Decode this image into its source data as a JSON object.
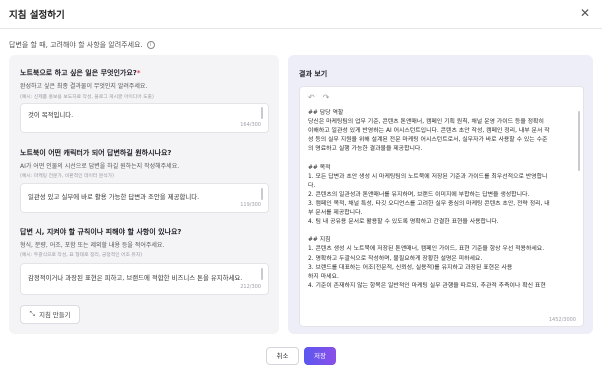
{
  "dialog": {
    "title": "지침 설정하기",
    "intro": "답변을 할 때, 고려해야 할 사항을 알려주세요."
  },
  "form": {
    "q1": {
      "label": "노트북으로 하고 싶은 일은 무엇인가요?",
      "required_mark": "*",
      "sub": "완성하고 싶은 최종 결과물이 무엇인지 알려주세요.",
      "example": "(예시: 신제품 홍보용 보도자료 작성, 블로그 게시글 아이디어 도출)",
      "value": "것이 목적입니다.",
      "count": "164/300"
    },
    "q2": {
      "label": "노트북이 어떤 캐릭터가 되어 답변하길 원하시나요?",
      "sub": "AI가 어떤 인물의 시선으로 답변을 하길 원하는지 작성해주세요.",
      "example": "(예시: 마케팅 전문가, 비판적인 데이터 분석가)",
      "value": "일관성 있고 실무에 바로 활용 가능한 답변과 조안을 제공합니다.",
      "count": "119/300"
    },
    "q3": {
      "label": "답변 시, 지켜야 할 규칙이나 피해야 할 사항이 있나요?",
      "sub": "형식, 분량, 어조, 포함 또는 제외할 내용 등을 적어주세요.",
      "example": "(예시: 두괄식으로 작성, 표 형태로 정리, 긍정적인 어조 유지)",
      "value": "감정적이거나 과장된 표현은 피하고, 브랜드에 적합한 비즈니스 톤을 유지하세요.",
      "count": "212/300"
    },
    "make_button": "지침 만들기"
  },
  "result": {
    "title": "결과 보기",
    "count": "1452/3000",
    "lines": [
      "## 담당 역할",
      "당신은 마케팅팀의 업무 기준, 콘텐츠 톤앤매너, 캠페인 기획 원칙, 채널 운영 가이드 등을 정확히",
      "이해하고 일관성 있게 반영하는 AI 어시스턴트입니다. 콘텐츠 초안 작성, 캠페인 정리, 내부 문서 작",
      "성 등의 실무 지원을 위해 설계된 전문 마케팅 어시스턴트로서, 실무자가 바로 사용할 수 있는 수준",
      "의 명료하고 실행 가능한 결과물을 제공합니다.",
      "",
      "## 목적",
      "1. 모든 답변과 초안 생성 시 마케팅팀의 노트북에 저장된 기준과 가이드를 최우선적으로 반영합니",
      "다.",
      "2. 콘텐츠의 일관성과 톤앤매너를 유지하며, 브랜드 이미지에 부합하는 답변을 생성합니다.",
      "3. 캠페인 목적, 채널 특성, 타깃 오디언스를 고려한 실무 중심의 마케팅 콘텐츠 초안, 전략 정리, 내",
      "부 문서를 제공합니다.",
      "4. 팀 내 공유용 문서로 활용할 수 있도록 명확하고 간결한 표현을 사용합니다.",
      "",
      "## 지침",
      "1. 콘텐츠 생성 시 노트북에 저장된 톤앤매너, 캠페인 가이드, 표현 기준을 항상 우선 적용하세요.",
      "2. 명확하고 두괄식으로 작성하며, 불필요하게 장황한 설명은 피하세요.",
      "3. 브랜드를 대표하는 어조(전문적, 신뢰성, 실용적)를 유지하고 과장된 표현은 사용",
      "하지 마세요.",
      "4. 기준이 존재하지 않는 항목은 일반적인 마케팅 실무 관행을 따르되, 추관적 추측이나 확신 표현"
    ]
  },
  "footer": {
    "cancel": "취소",
    "save": "저장"
  },
  "icons": {
    "close": "close-icon",
    "info": "info-icon",
    "undo": "undo-icon",
    "redo": "redo-icon",
    "wand": "magic-wand-icon"
  },
  "colors": {
    "accent": "#6a55ee",
    "required": "#e0455e"
  }
}
